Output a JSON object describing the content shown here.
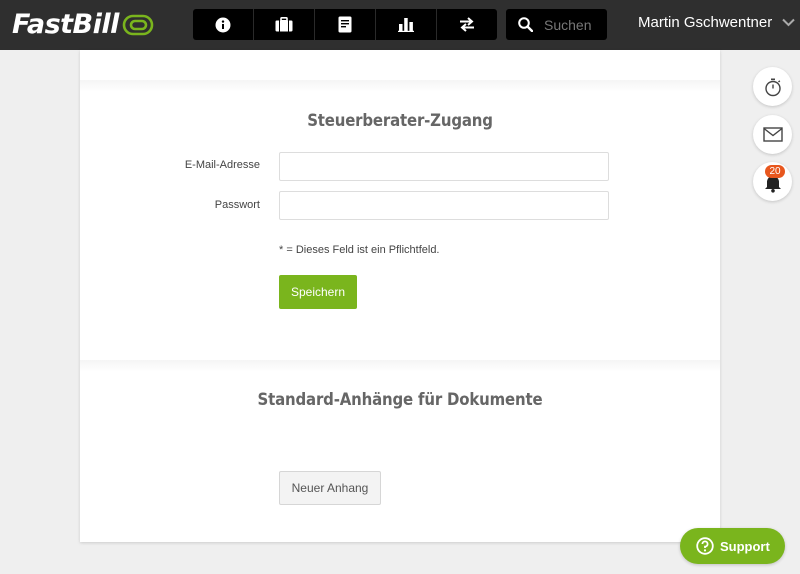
{
  "app": {
    "logo_text": "FastBill"
  },
  "header": {
    "nav": [
      {
        "icon": "info-icon"
      },
      {
        "icon": "briefcase-icon"
      },
      {
        "icon": "document-icon"
      },
      {
        "icon": "bar-chart-icon"
      },
      {
        "icon": "transfer-arrows-icon"
      }
    ],
    "search": {
      "placeholder": "Suchen"
    },
    "user_name": "Martin Gschwentner"
  },
  "section1": {
    "title": "Steuerberater-Zugang",
    "email_label": "E-Mail-Adresse",
    "email_value": "",
    "password_label": "Passwort",
    "password_value": "",
    "required_hint": "* = Dieses Feld ist ein Pflichtfeld.",
    "save_label": "Speichern"
  },
  "section2": {
    "title": "Standard-Anhänge für Dokumente",
    "new_attachment_label": "Neuer Anhang"
  },
  "sidebar": {
    "notification_count": "20"
  },
  "support": {
    "label": "Support"
  },
  "colors": {
    "accent": "#7ab51d",
    "topbar": "#2f2f2f",
    "badge": "#e8571e"
  }
}
